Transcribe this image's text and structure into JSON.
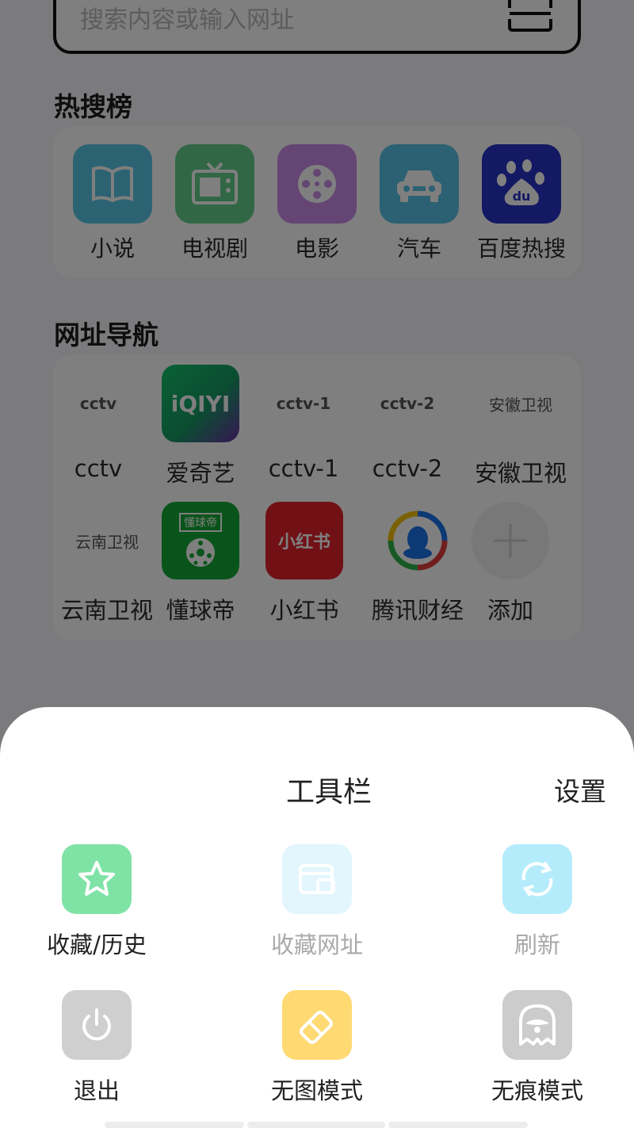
{
  "search": {
    "placeholder": "搜索内容或输入网址",
    "scan_icon": "scan-icon"
  },
  "hot": {
    "title": "热搜榜",
    "items": [
      {
        "label": "小说",
        "icon": "book-icon",
        "color": "#59c6e6"
      },
      {
        "label": "电视剧",
        "icon": "tv-icon",
        "color": "#63cf8a"
      },
      {
        "label": "电影",
        "icon": "film-reel-icon",
        "color": "#c98be8"
      },
      {
        "label": "汽车",
        "icon": "car-icon",
        "color": "#56c3e5"
      },
      {
        "label": "百度热搜",
        "icon": "baidu-paw-icon",
        "color": "#2932c9"
      }
    ]
  },
  "nav": {
    "title": "网址导航",
    "items": [
      {
        "label": "cctv",
        "tile_text": "cctv"
      },
      {
        "label": "爱奇艺",
        "tile_text": "iQIYI"
      },
      {
        "label": "cctv-1",
        "tile_text": "cctv-1"
      },
      {
        "label": "cctv-2",
        "tile_text": "cctv-2"
      },
      {
        "label": "安徽卫视",
        "tile_text": "安徽卫视"
      },
      {
        "label": "云南卫视",
        "tile_text": "云南卫视"
      },
      {
        "label": "懂球帝",
        "tile_text": "懂球帝"
      },
      {
        "label": "小红书",
        "tile_text": "小红书"
      },
      {
        "label": "腾讯财经",
        "tile_text": ""
      },
      {
        "label": "添加",
        "tile_text": ""
      }
    ]
  },
  "toolbar": {
    "title": "工具栏",
    "settings": "设置",
    "tools": [
      {
        "label": "收藏/历史",
        "icon": "star-icon",
        "color": "#7fe3a6",
        "enabled": true
      },
      {
        "label": "收藏网址",
        "icon": "bookmark-card-icon",
        "color": "#e3f6fd",
        "enabled": false
      },
      {
        "label": "刷新",
        "icon": "refresh-icon",
        "color": "#b4ecfb",
        "enabled": false
      },
      {
        "label": "退出",
        "icon": "power-icon",
        "color": "#cfcfcf",
        "enabled": true
      },
      {
        "label": "无图模式",
        "icon": "eraser-icon",
        "color": "#ffd972",
        "enabled": true
      },
      {
        "label": "无痕模式",
        "icon": "ghost-icon",
        "color": "#cccccc",
        "enabled": true
      }
    ]
  }
}
